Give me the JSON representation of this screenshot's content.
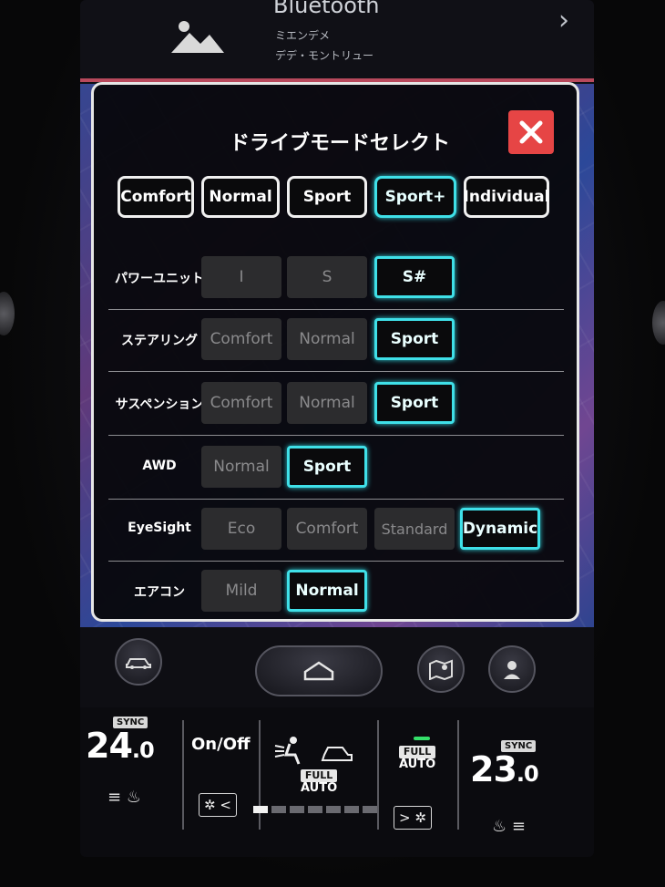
{
  "media": {
    "title": "Bluetooth",
    "line1": "ミエンデメ",
    "line2": "デデ・モントリュー"
  },
  "dialog": {
    "title": "ドライブモードセレクト",
    "modes": [
      {
        "label": "Comfort",
        "active": false
      },
      {
        "label": "Normal",
        "active": false
      },
      {
        "label": "Sport",
        "active": false
      },
      {
        "label": "Sport+",
        "active": true
      },
      {
        "label": "Individual",
        "active": false
      }
    ],
    "settings": [
      {
        "label": "パワーユニット",
        "options": [
          {
            "label": "I",
            "active": false
          },
          {
            "label": "S",
            "active": false
          },
          {
            "label": "S#",
            "active": true
          }
        ]
      },
      {
        "label": "ステアリング",
        "options": [
          {
            "label": "Comfort",
            "active": false
          },
          {
            "label": "Normal",
            "active": false
          },
          {
            "label": "Sport",
            "active": true
          }
        ]
      },
      {
        "label": "サスペンション",
        "options": [
          {
            "label": "Comfort",
            "active": false
          },
          {
            "label": "Normal",
            "active": false
          },
          {
            "label": "Sport",
            "active": true
          }
        ]
      },
      {
        "label": "AWD",
        "options": [
          {
            "label": "Normal",
            "active": false
          },
          {
            "label": "Sport",
            "active": true
          }
        ]
      },
      {
        "label": "EyeSight",
        "options": [
          {
            "label": "Eco",
            "active": false
          },
          {
            "label": "Comfort",
            "active": false
          },
          {
            "label": "Standard",
            "active": false
          },
          {
            "label": "Dynamic",
            "active": true
          }
        ]
      },
      {
        "label": "エアコン",
        "options": [
          {
            "label": "Mild",
            "active": false
          },
          {
            "label": "Normal",
            "active": true
          }
        ]
      }
    ]
  },
  "climate": {
    "left_sync": "SYNC",
    "left_temp": "24",
    "left_temp_decimal": ".0",
    "onoff": "On/Off",
    "airflow_full": "FULL",
    "airflow_auto": "AUTO",
    "fan_full": "FULL",
    "fan_auto": "AUTO",
    "right_sync": "SYNC",
    "right_temp": "23",
    "right_temp_decimal": ".0",
    "fan_level": 0.14
  },
  "colors": {
    "accent": "#3fe0e8",
    "close": "#e64545"
  }
}
